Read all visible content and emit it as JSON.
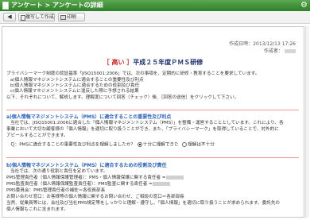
{
  "window": {
    "title": "アンケート > アンケートの詳細",
    "gear_icon": "gear-icon"
  },
  "toolbar": {
    "back_label": "◀",
    "copy_label": "複写して作成",
    "print_label": "印刷"
  },
  "meta": {
    "created_label": "作成日時：2013/12/13 17:26",
    "author_label": "作成者："
  },
  "doc_title": {
    "prefix": "［ 高い ］",
    "main": "平成２５年度ＰＭＳ研修"
  },
  "intro": [
    "プライバシーマーク制度の認証基準「JISQ15001:2006」では、次の事項を、定期的に研修・教育することを要求しています。",
    "a)個人情報マネジメントシステムに適合することの重要性及び利点",
    "b)個人情報マネジメントシステムに適合するための役割及び責任",
    "c)個人情報マネジメントシステムに違反した際に予想される結果",
    "以下、それぞれについて、解説します。理解度について回答（チェック）後、［回答の送信］をクリックして下さい。"
  ],
  "section_a": {
    "heading": "a)個人情報マネジメントシステム（PMS）に適合することの重要性及び利点",
    "lines": [
      "当社では、JISQ15001:2006に適合した「個人情報マネジメントシステム（PMS）」を整備・運営することとしています。これにより、各",
      "事業において大切な顧客様の「個人情報」を適切に取り扱うことができ、また、「プライバシーマーク」を取得していることで、対外的に",
      "アピールすることができます。"
    ],
    "question": "Ｑ：PMSに適合することの重要性及び利点を理解しましたか？",
    "option_yes": "十分に理解できた",
    "option_no": "理解は不十分"
  },
  "section_b": {
    "heading": "b)個人情報マネジメントシステム（PMS）に適合するための役割及び責任",
    "lines": [
      "当社では、次の通り役割と責任を定めています。",
      "PMS管理責任者（個人情報保護管理者）：PMS・個人情報保護に関する責任者 =",
      "PMS監査責任者（個人情報保護監査責任者）：PMS監査に関する責任者 =",
      "PMS委員会：PMS管理責任者の補佐＝各役員部長",
      "お問い合わせ窓口：お客様等の個人情報に関するお問い合わせ、ご相談の窓口＝各部部長",
      "当然、従業員等には、会社及び当社PMS規定等をしっかりと理解・遵守し、「個人情報」を適切に取り扱うことが求められます。委託先の",
      "個人情報もこれに含まれます。"
    ]
  }
}
